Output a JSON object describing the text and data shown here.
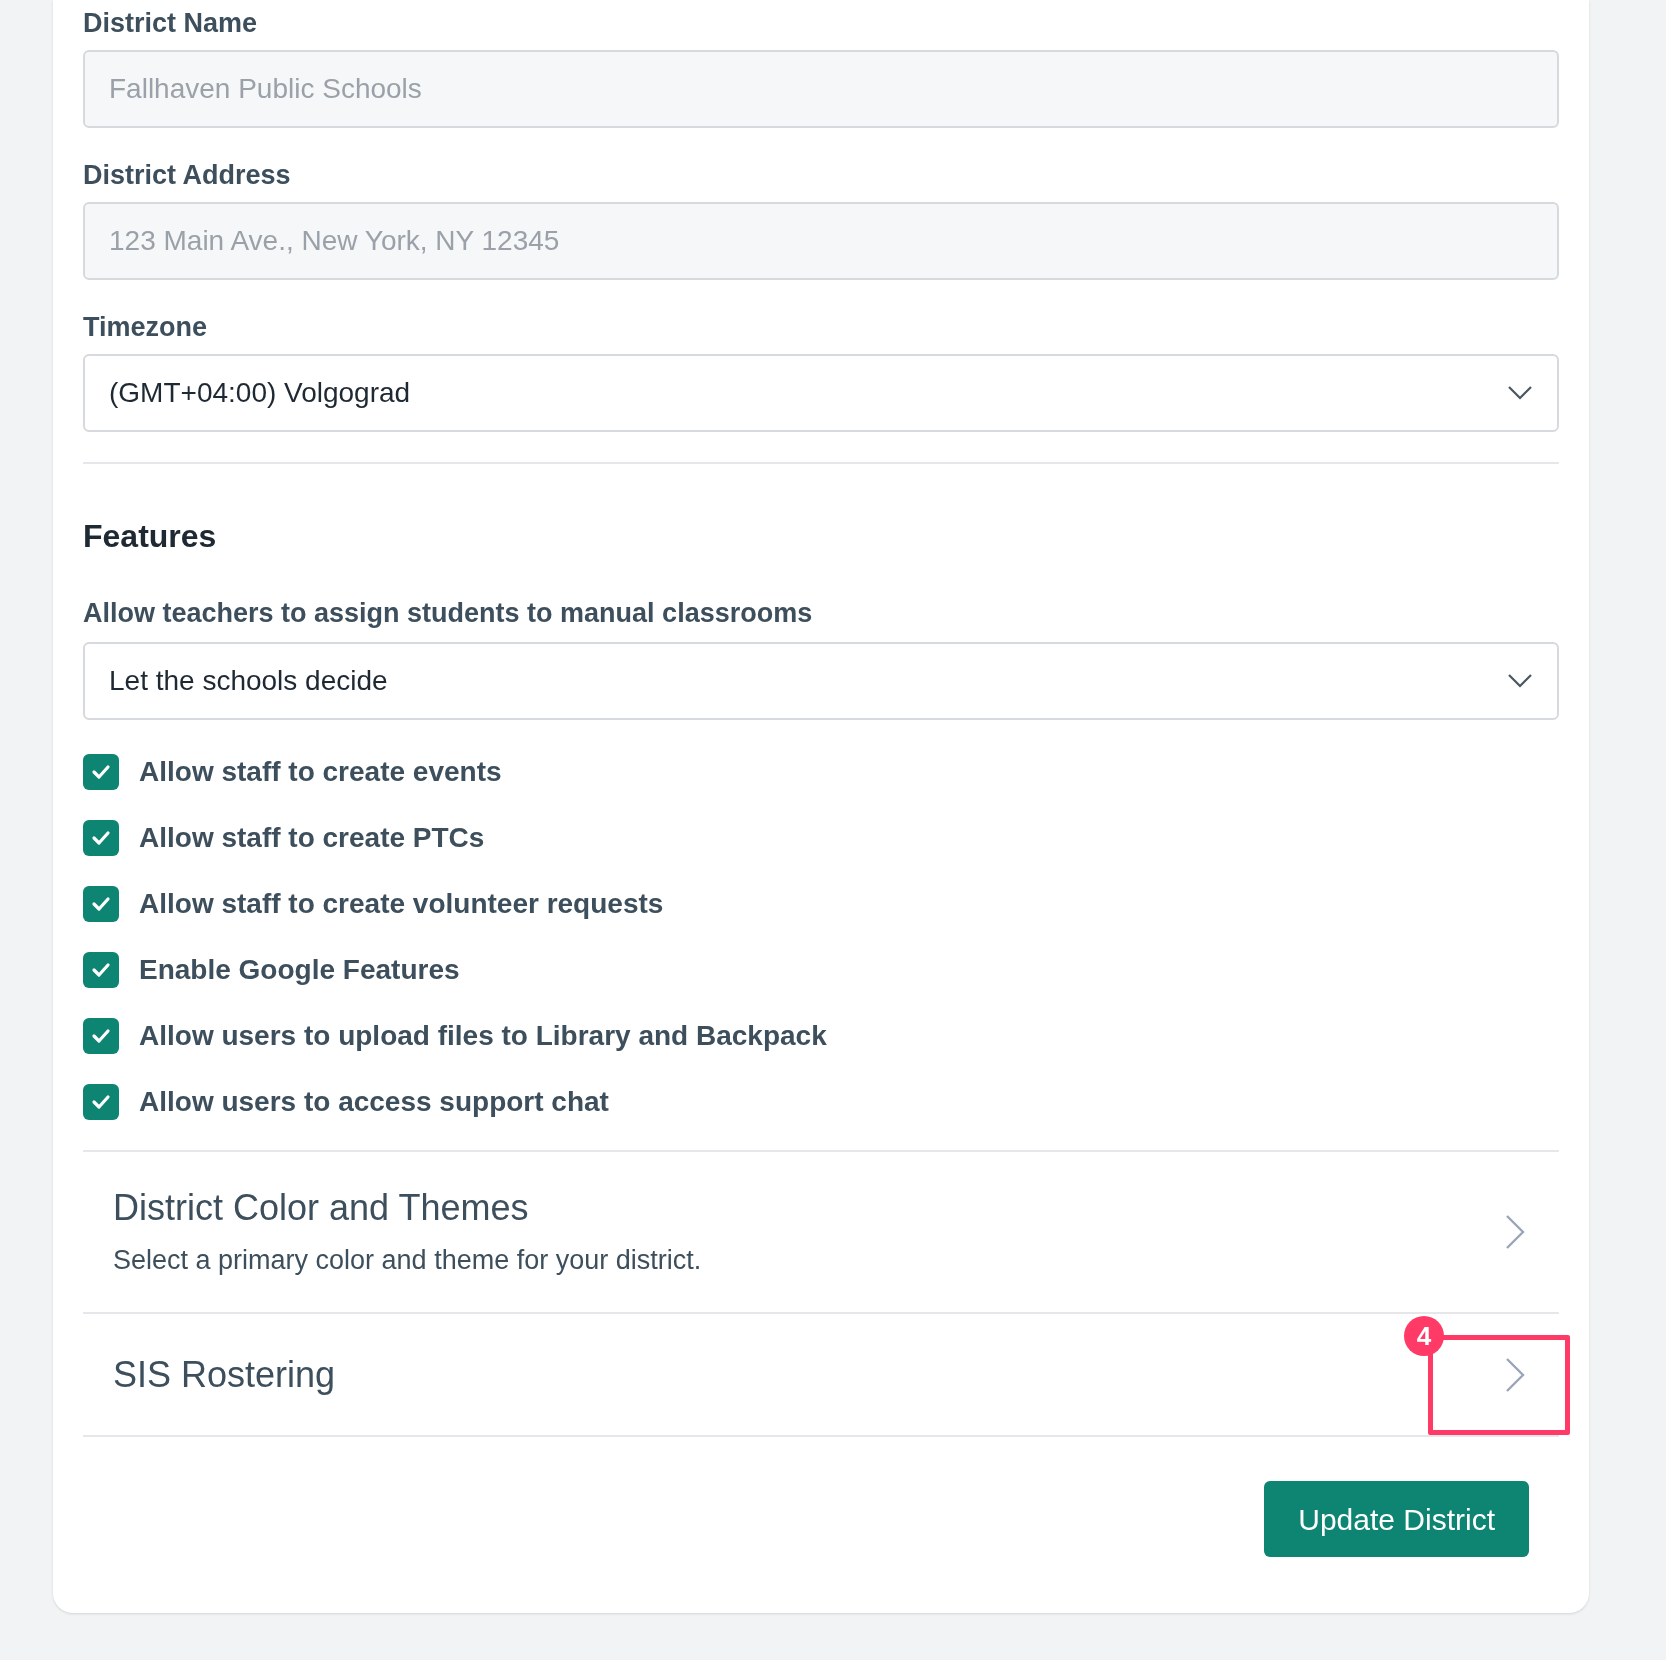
{
  "fields": [
    {
      "label": "District Name",
      "placeholder": "Fallhaven Public Schools"
    },
    {
      "label": "District Address",
      "placeholder": "123 Main Ave., New York, NY 12345"
    }
  ],
  "timezone": {
    "label": "Timezone",
    "value": "(GMT+04:00) Volgograd"
  },
  "features": {
    "title": "Features",
    "question": "Allow teachers to assign students to manual classrooms",
    "question_value": "Let the schools decide",
    "options": [
      {
        "label": "Allow staff to create events",
        "checked": true
      },
      {
        "label": "Allow staff to create PTCs",
        "checked": true
      },
      {
        "label": "Allow staff to create volunteer requests",
        "checked": true
      },
      {
        "label": "Enable Google Features",
        "checked": true
      },
      {
        "label": "Allow users to upload files to Library and Backpack",
        "checked": true
      },
      {
        "label": "Allow users to access support chat",
        "checked": true
      }
    ]
  },
  "sections": [
    {
      "title": "District Color and Themes",
      "subtitle": "Select a primary color and theme for your district.",
      "highlighted": false
    },
    {
      "title": "SIS Rostering",
      "highlighted": true
    }
  ],
  "annotation": {
    "label": "4"
  },
  "button": "Update District"
}
